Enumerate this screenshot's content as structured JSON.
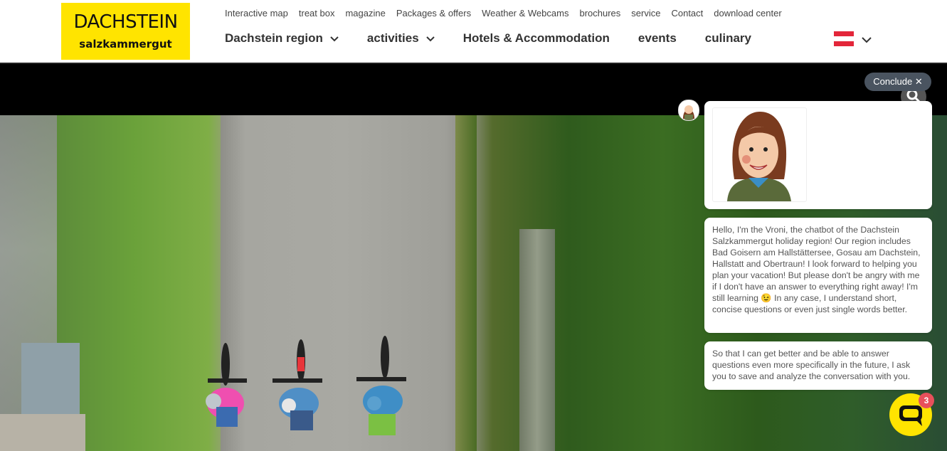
{
  "logo": {
    "line1": "DACHSTEIN",
    "line2": "salzkammergut",
    "bg_color": "#ffe400"
  },
  "top_nav": [
    "Interactive map",
    "treat box",
    "magazine",
    "Packages & offers",
    "Weather & Webcams",
    "brochures",
    "service",
    "Contact",
    "download center"
  ],
  "main_nav": [
    {
      "label": "Dachstein region",
      "dropdown": true
    },
    {
      "label": "activities",
      "dropdown": true
    },
    {
      "label": "Hotels & Accommodation",
      "dropdown": false
    },
    {
      "label": "events",
      "dropdown": false
    },
    {
      "label": "culinary",
      "dropdown": false
    }
  ],
  "language": {
    "flag": "austria-flag",
    "dropdown_icon": "chevron-down-icon"
  },
  "chat": {
    "conclude_label": "Conclude ✕",
    "bot_avatar_icon": "vroni-avatar-icon",
    "message_1": "Hello, I'm the Vroni, the chatbot of the Dachstein Salzkammergut holiday region! Our region includes Bad Goisern am Hallstättersee, Gosau am Dachstein, Hallstatt and Obertraun! I look forward to helping you plan your vacation! But please don't be angry with me if I don't have an answer to everything right away! I'm still learning 😉 In any case, I understand short, concise questions or even just single words better.",
    "message_2": "So that I can get better and be able to answer questions even more specifically in the future, I ask you to save and analyze the conversation with you.",
    "launcher_icon": "chat-bubble-icon",
    "unread_count": "3"
  }
}
